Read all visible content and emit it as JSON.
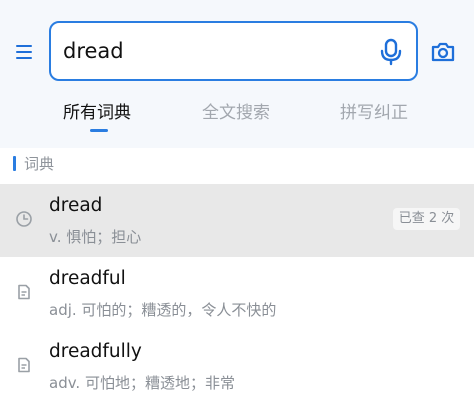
{
  "search": {
    "value": "dread"
  },
  "icons": {
    "menu": "menu-icon",
    "mic": "microphone-icon",
    "camera": "camera-icon",
    "history": "clock-icon",
    "entry": "document-icon"
  },
  "tabs": [
    {
      "label": "所有词典",
      "active": true
    },
    {
      "label": "全文搜索",
      "active": false
    },
    {
      "label": "拼写纠正",
      "active": false
    }
  ],
  "section": {
    "title": "词典"
  },
  "results": [
    {
      "word": "dread",
      "definition": "v. 惧怕；担心",
      "badge": "已查 2 次",
      "icon": "clock-icon"
    },
    {
      "word": "dreadful",
      "definition": "adj. 可怕的；糟透的，令人不快的",
      "icon": "document-icon"
    },
    {
      "word": "dreadfully",
      "definition": "adv. 可怕地；糟透地；非常",
      "icon": "document-icon"
    }
  ],
  "colors": {
    "accent": "#2a7de1",
    "header_bg": "#f5f8fc",
    "highlight_row": "#e8e8e8",
    "muted_text": "#8a8f96"
  }
}
